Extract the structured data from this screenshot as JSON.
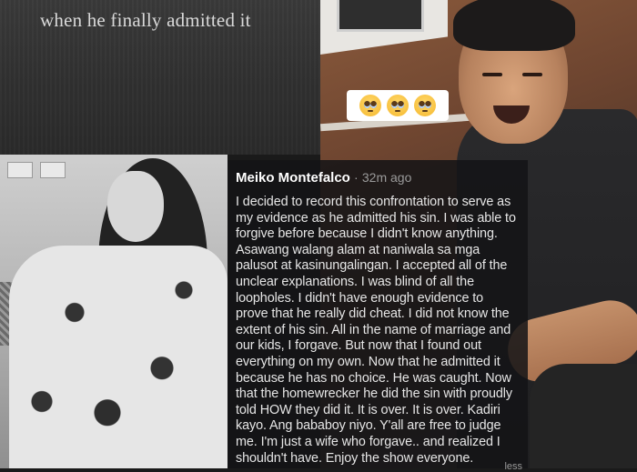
{
  "caption": "when he finally admitted it",
  "reaction": {
    "emojis": [
      "pleading-face-icon",
      "pleading-face-icon",
      "pleading-face-icon"
    ]
  },
  "comment": {
    "author": "Meiko Montefalco",
    "separator": "·",
    "time": "32m ago",
    "body": "I decided to record this confrontation to serve as my evidence as he admitted his sin. I was able to forgive before because I didn't know anything. Asawang walang alam at naniwala sa mga palusot at kasinungalingan. I accepted all of the unclear explanations. I was blind of all the loopholes. I didn't have enough evidence to prove that he really did cheat. I did not know the extent of his sin. All in the name of marriage and our kids, I forgave. But now that I found out everything on my own. Now that he admitted it because he has no choice. He was caught. Now that the homewrecker he did the sin with proudly told HOW they did it. It is over. It is over. Kadiri kayo. Ang bababoy niyo. Y'all are free to judge me. I'm just a wife who forgave.. and realized I shouldn't have. Enjoy the show everyone.",
    "truncated_text": "less"
  },
  "colors": {
    "comment_bg": "#141416",
    "comment_text": "#e6e6e6",
    "meta_text": "#9a9a9a",
    "caption_text": "#d9d9d9"
  }
}
